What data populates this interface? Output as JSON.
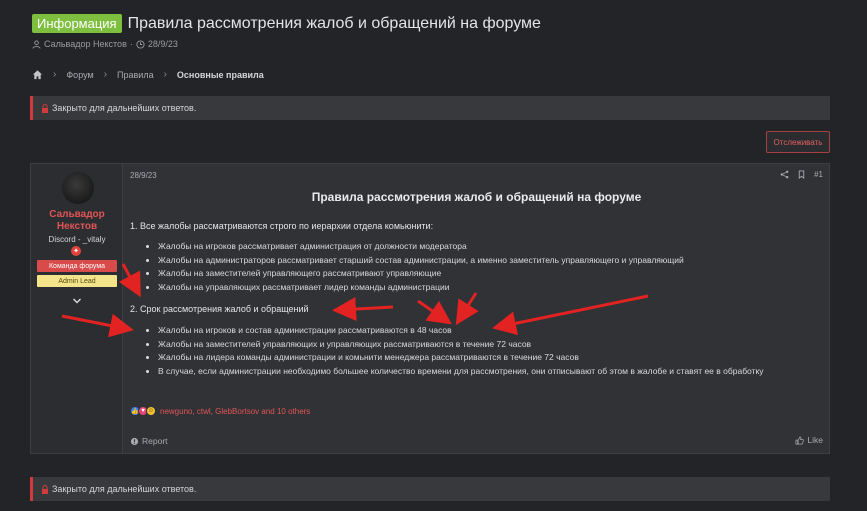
{
  "thread": {
    "prefix": "Информация",
    "title": "Правила рассмотрения жалоб и обращений на форуме",
    "author": "Сальвадор Некстов",
    "date": "28/9/23"
  },
  "breadcrumb": {
    "items": [
      "Форум",
      "Правила"
    ],
    "current": "Основные правила"
  },
  "notice_top": "Закрыто для дальнейших ответов.",
  "notice_bottom": "Закрыто для дальнейших ответов.",
  "watch_button": "Отслеживать",
  "user": {
    "name_line1": "Сальвадор",
    "name_line2": "Некстов",
    "discord": "Discord - _vitaly",
    "role1": "Команда форума",
    "role2": "Admin Lead"
  },
  "post": {
    "date": "28/9/23",
    "number": "#1",
    "title": "Правила рассмотрения жалоб и обращений на форуме",
    "section1": "1. Все жалобы рассматриваются строго по иерархии отдела комьюнити:",
    "list1": [
      "Жалобы на игроков рассматривает администрация от должности модератора",
      "Жалобы на администраторов рассматривает старший состав администрации, а именно заместитель управляющего и управляющий",
      "Жалобы на заместителей управляющего рассматривают управляющие",
      "Жалобы на управляющих рассматривает лидер команды администрации"
    ],
    "section2": "2. Срок рассмотрения жалоб и обращений",
    "list2": [
      "Жалобы на игроков и состав администрации рассматриваются в 48 часов",
      "Жалобы на заместителей управляющих и управляющих рассматриваются в течение 72 часов",
      "Жалобы на лидера команды администрации и комьнити менеджера рассматриваются в течение 72 часов",
      "В случае, если администрации необходимо большее количество времени для рассмотрения, они отписывают об этом в жалобе и ставят ее в обработку"
    ],
    "reactions_text": "newguno, ctwl, GlebBortsov and 10 others",
    "report_label": "Report",
    "like_label": "Like"
  },
  "colors": {
    "accent_red": "#d94a4a",
    "prefix_green": "#7fbf3f",
    "background": "#232427"
  }
}
